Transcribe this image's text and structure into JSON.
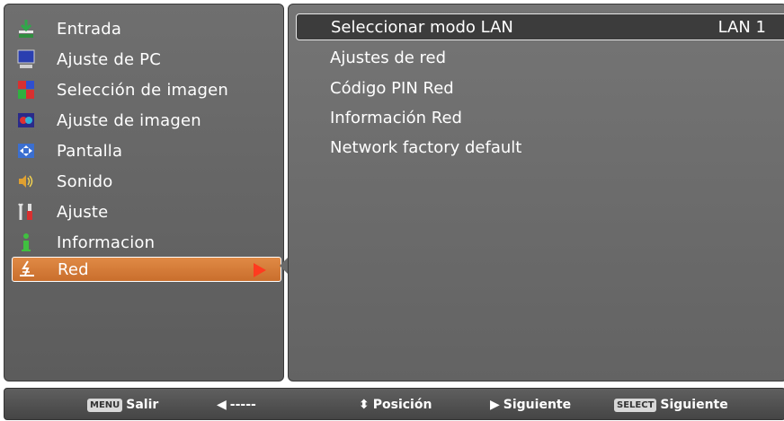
{
  "menu": {
    "items": [
      {
        "label": "Entrada",
        "icon": "input-arrow-icon"
      },
      {
        "label": "Ajuste de PC",
        "icon": "monitor-icon"
      },
      {
        "label": "Selección de imagen",
        "icon": "color-bars-icon"
      },
      {
        "label": "Ajuste de imagen",
        "icon": "image-adjust-icon"
      },
      {
        "label": "Pantalla",
        "icon": "screen-arrows-icon"
      },
      {
        "label": "Sonido",
        "icon": "speaker-icon"
      },
      {
        "label": "Ajuste",
        "icon": "tools-icon"
      },
      {
        "label": "Informacion",
        "icon": "info-icon"
      },
      {
        "label": "Red",
        "icon": "network-icon"
      }
    ],
    "selected_index": 8
  },
  "submenu": {
    "items": [
      {
        "label": "Seleccionar modo LAN",
        "value": "LAN 1"
      },
      {
        "label": "Ajustes de red"
      },
      {
        "label": "Código PIN Red"
      },
      {
        "label": "Información Red"
      },
      {
        "label": "Network factory default"
      }
    ]
  },
  "footer": {
    "menu_key": "MENU",
    "menu_label": "Salir",
    "back_label": "-----",
    "position_label": "Posición",
    "next_label": "Siguiente",
    "select_key": "SELECT",
    "select_label": "Siguiente"
  },
  "colors": {
    "selected_bg": "#d57a38",
    "panel_bg": "#6a6a6a",
    "arrow": "#ff3b1f"
  }
}
